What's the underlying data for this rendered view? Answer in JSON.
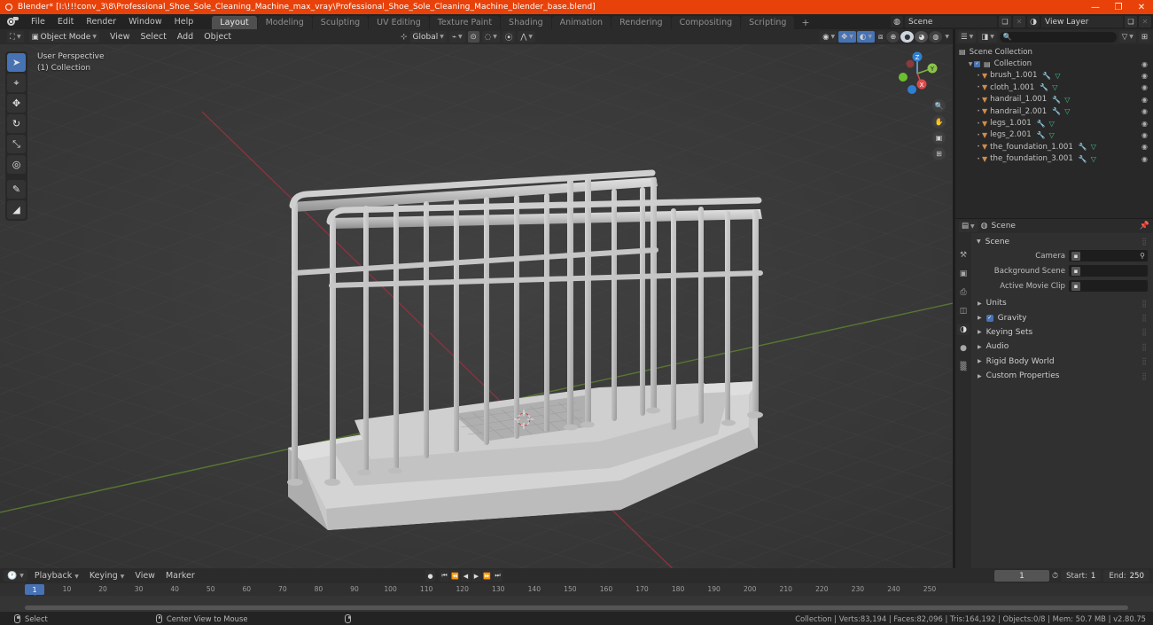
{
  "titlebar": {
    "title": "Blender* [I:\\!!!conv_3\\8\\Professional_Shoe_Sole_Cleaning_Machine_max_vray\\Professional_Shoe_Sole_Cleaning_Machine_blender_base.blend]",
    "minimize": "—",
    "maximize": "❐",
    "close": "✕",
    "accent_color": "#e8420a"
  },
  "topbar": {
    "menus": [
      "File",
      "Edit",
      "Render",
      "Window",
      "Help"
    ],
    "workspaces": [
      {
        "label": "Layout",
        "active": true
      },
      {
        "label": "Modeling",
        "active": false
      },
      {
        "label": "Sculpting",
        "active": false
      },
      {
        "label": "UV Editing",
        "active": false
      },
      {
        "label": "Texture Paint",
        "active": false
      },
      {
        "label": "Shading",
        "active": false
      },
      {
        "label": "Animation",
        "active": false
      },
      {
        "label": "Rendering",
        "active": false
      },
      {
        "label": "Compositing",
        "active": false
      },
      {
        "label": "Scripting",
        "active": false
      }
    ],
    "add_workspace": "+",
    "scene_name": "Scene",
    "view_layer_name": "View Layer"
  },
  "viewport_header": {
    "mode": "Object Mode",
    "menus": [
      "View",
      "Select",
      "Add",
      "Object"
    ],
    "transform_orientation": "Global",
    "overlay_icons": [
      "snap-magnet-icon",
      "proportional-edit-icon"
    ]
  },
  "viewport": {
    "perspective_label": "User Perspective",
    "collection_label": "(1) Collection",
    "background_color": "#3b3b3b",
    "tools": [
      {
        "name": "tweak-select-tool",
        "glyph": "➤",
        "active": true
      },
      {
        "name": "cursor-tool",
        "glyph": "⌖",
        "active": false
      },
      {
        "name": "move-tool",
        "glyph": "✥",
        "active": false
      },
      {
        "name": "rotate-tool",
        "glyph": "↻",
        "active": false
      },
      {
        "name": "scale-tool",
        "glyph": "⤡",
        "active": false
      },
      {
        "name": "transform-tool",
        "glyph": "◎",
        "active": false
      },
      {
        "name": "annotate-tool",
        "glyph": "✎",
        "active": false
      },
      {
        "name": "measure-tool",
        "glyph": "◢",
        "active": false
      }
    ],
    "gizmo_axes": [
      "X",
      "Y",
      "Z"
    ]
  },
  "outliner": {
    "search_placeholder": "",
    "rows": [
      {
        "label": "Scene Collection",
        "indent": 0,
        "type": "scene-collection",
        "modifier": false,
        "mesh": false,
        "eye": false,
        "checkbox": false
      },
      {
        "label": "Collection",
        "indent": 1,
        "type": "collection",
        "modifier": false,
        "mesh": false,
        "eye": true,
        "checkbox": true
      },
      {
        "label": "brush_1.001",
        "indent": 2,
        "type": "object",
        "modifier": true,
        "mesh": true,
        "eye": true,
        "checkbox": false
      },
      {
        "label": "cloth_1.001",
        "indent": 2,
        "type": "object",
        "modifier": true,
        "mesh": true,
        "eye": true,
        "checkbox": false
      },
      {
        "label": "handrail_1.001",
        "indent": 2,
        "type": "object",
        "modifier": true,
        "mesh": true,
        "eye": true,
        "checkbox": false
      },
      {
        "label": "handrail_2.001",
        "indent": 2,
        "type": "object",
        "modifier": true,
        "mesh": true,
        "eye": true,
        "checkbox": false
      },
      {
        "label": "legs_1.001",
        "indent": 2,
        "type": "object",
        "modifier": true,
        "mesh": true,
        "eye": true,
        "checkbox": false
      },
      {
        "label": "legs_2.001",
        "indent": 2,
        "type": "object",
        "modifier": true,
        "mesh": true,
        "eye": true,
        "checkbox": false
      },
      {
        "label": "the_foundation_1.001",
        "indent": 2,
        "type": "object",
        "modifier": true,
        "mesh": true,
        "eye": true,
        "checkbox": false
      },
      {
        "label": "the_foundation_3.001",
        "indent": 2,
        "type": "object",
        "modifier": true,
        "mesh": true,
        "eye": true,
        "checkbox": false
      }
    ]
  },
  "properties": {
    "breadcrumb": "Scene",
    "tabs": [
      {
        "name": "tool-tab",
        "glyph": "⚒",
        "active": false
      },
      {
        "name": "render-tab",
        "glyph": "▣",
        "active": false
      },
      {
        "name": "output-tab",
        "glyph": "⎙",
        "active": false
      },
      {
        "name": "view-layer-tab",
        "glyph": "◫",
        "active": false
      },
      {
        "name": "scene-tab",
        "glyph": "◑",
        "active": true
      },
      {
        "name": "world-tab",
        "glyph": "●",
        "active": false
      },
      {
        "name": "texture-tab",
        "glyph": "▒",
        "active": false
      }
    ],
    "panel_title": "Scene",
    "fields": [
      {
        "label": "Camera",
        "value": "",
        "icon": "camera-icon",
        "eyedropper": true
      },
      {
        "label": "Background Scene",
        "value": "",
        "icon": "scene-icon",
        "eyedropper": false
      },
      {
        "label": "Active Movie Clip",
        "value": "",
        "icon": "clapper-icon",
        "eyedropper": false
      }
    ],
    "sections": [
      {
        "label": "Units",
        "checkbox": false,
        "expanded": false
      },
      {
        "label": "Gravity",
        "checkbox": true,
        "expanded": false
      },
      {
        "label": "Keying Sets",
        "checkbox": false,
        "expanded": false
      },
      {
        "label": "Audio",
        "checkbox": false,
        "expanded": false
      },
      {
        "label": "Rigid Body World",
        "checkbox": false,
        "expanded": false
      },
      {
        "label": "Custom Properties",
        "checkbox": false,
        "expanded": false
      }
    ]
  },
  "timeline": {
    "menus": [
      "Playback",
      "Keying",
      "View",
      "Marker"
    ],
    "transport": [
      "⏮",
      "⏪",
      "◀",
      "▶",
      "⏩",
      "⏭"
    ],
    "record_icon": "●",
    "current_frame": "1",
    "start_label": "Start:",
    "start_value": "1",
    "end_label": "End:",
    "end_value": "250",
    "ruler_ticks": [
      10,
      20,
      30,
      40,
      50,
      60,
      70,
      80,
      90,
      100,
      110,
      120,
      130,
      140,
      150,
      160,
      170,
      180,
      190,
      200,
      210,
      220,
      230,
      240,
      250
    ],
    "playhead_frame": "1"
  },
  "statusbar": {
    "left_items": [
      {
        "icon": "mouse-left-icon",
        "label": "Select"
      },
      {
        "icon": "mouse-middle-icon",
        "label": "Center View to Mouse"
      },
      {
        "icon": "mouse-right-icon",
        "label": ""
      }
    ],
    "stats": "Collection | Verts:83,194 | Faces:82,096 | Tris:164,192 | Objects:0/8 | Mem: 50.7 MB | v2.80.75"
  }
}
